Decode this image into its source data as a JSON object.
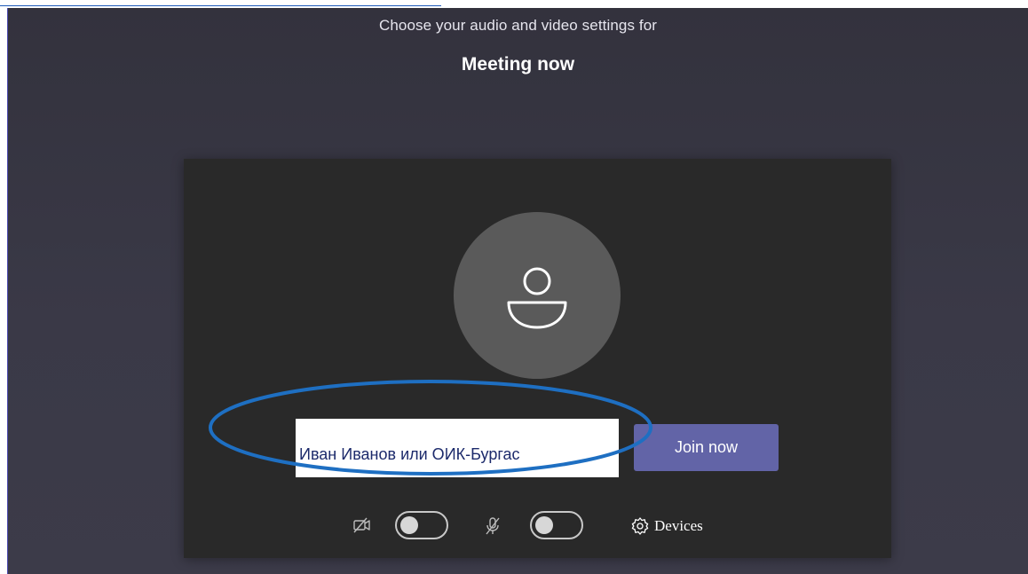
{
  "page": {
    "top_link_text": ""
  },
  "header": {
    "subtitle": "Choose your audio and video settings for",
    "meeting_title": "Meeting now"
  },
  "preview": {
    "avatar_icon": "person-icon",
    "name_value": "Иван Иванов или ОИК-Бургас",
    "join_label": "Join now"
  },
  "controls": {
    "camera_icon": "camera-off-icon",
    "mic_icon": "mic-off-icon",
    "camera_toggle_on": false,
    "mic_toggle_on": false,
    "devices_icon": "gear-icon",
    "devices_label": "Devices"
  },
  "colors": {
    "accent": "#6264a7",
    "background": "#3a3947",
    "preview_bg": "#292929",
    "annotation": "#1e6fc2"
  }
}
